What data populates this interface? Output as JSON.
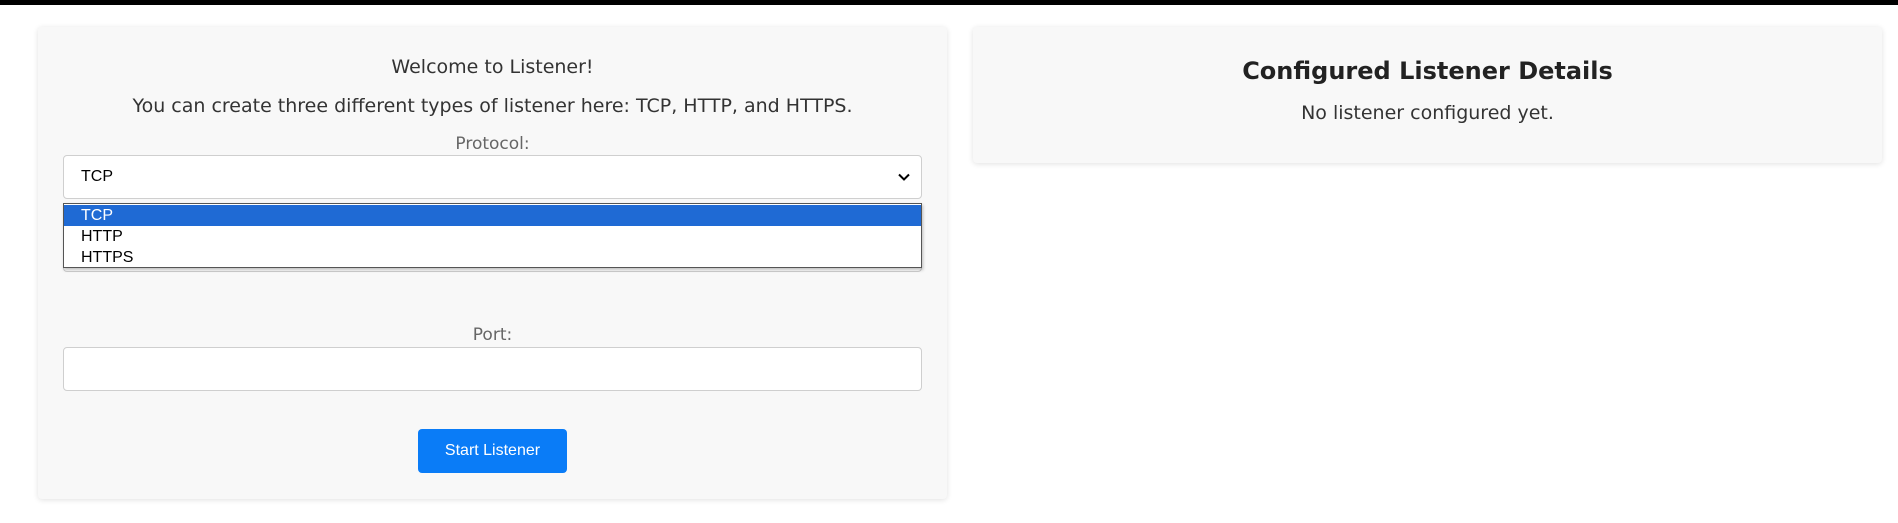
{
  "listener_form": {
    "welcome": "Welcome to Listener!",
    "subtitle": "You can create three different types of listener here: TCP, HTTP, and HTTPS.",
    "protocol_label": "Protocol:",
    "protocol_value": "TCP",
    "protocol_options": [
      "TCP",
      "HTTP",
      "HTTPS"
    ],
    "port_label": "Port:",
    "port_value": "",
    "start_button": "Start Listener"
  },
  "details": {
    "title": "Configured Listener Details",
    "status": "No listener configured yet."
  },
  "colors": {
    "accent": "#0a7cf7",
    "option_highlight": "#1f6ad4",
    "panel_bg": "#f8f8f8"
  },
  "icons": {
    "select_arrow": "chevron-down-icon"
  }
}
